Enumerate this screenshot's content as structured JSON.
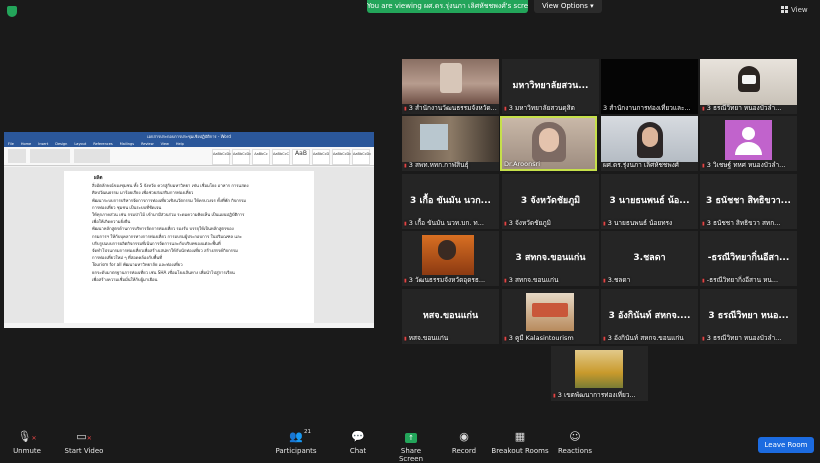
{
  "banner": {
    "text": "You are viewing ผศ.ดร.รุ่งนภา เลิศหัชชพงศ์'s screen"
  },
  "view_options": "View Options",
  "view_button": "View",
  "word": {
    "title": "เอกสารประกอบการประชุมเชิงปฏิบัติการ - Word",
    "tabs": [
      "File",
      "Home",
      "Insert",
      "Design",
      "Layout",
      "References",
      "Mailings",
      "Review",
      "View",
      "Help"
    ],
    "styles": [
      "AaBbCcDc",
      "AaBbCcDc",
      "AaBbCc",
      "AaBbCcC",
      "AaB",
      "AaBbCcD",
      "AaBbCcDc",
      "AaBbCcDc"
    ],
    "heading": "ผลิต",
    "lines": [
      "สิ่งอัตลักษณ์ของชุมชน ทั้ง 5 จังหวัด ควรสู่กับมหาวิทยา เช่น เชื่อมโยง อาหาร การแสดง",
      "ศิลปวัฒนธรรม มาร้อยเรียง เพื่อช่วยส่งเสริมการท่องเที่ยว",
      "พัฒนาระบบการบริหารจัดการการท่องเที่ยวเชิงนวัตกรรม ให้ครบวงจร ทั้งที่พัก กิจกรรม",
      "การท่องเที่ยว ชุมชน เป็นระบบที่ชัดเจน",
      "ให้ทุกภาคส่วน เช่น กรมป่าไม้ เข้ามามีส่วนร่วม ระดมความคิดเห็น เป็นแผนปฏิบัติการ",
      "เพื่อให้เกิดความยั่งยืน",
      "พัฒนาหลักสูตรด้านการบริหารจัดการท่องเที่ยว รองรับ บรรจุให้เป็นหลักสูตรของ",
      "กรมการฯ ให้กับบุคลากรทางการท่องเที่ยว การอบรมผู้ประกอบการ ในปริมณฑล และ",
      "ปรับรูปแบบการผลิตกิจกรรมที่เน้นการจัดการและกับบริบทของแต่ละพื้นที่",
      "จัดทำโปรแกรมการท่องเที่ยวเพื่อสร้างเสน่หาให้กับนักท่องเที่ยว สร้างสรรค์กิจกรรม",
      "การท่องเที่ยวใหม่ ๆ ที่สอดคล้องกับพื้นที่",
      "Tourism for all พัฒนามหาวิทยาลัย และท่องเที่ยว",
      "ยกระดับมาตรฐานการท่องเที่ยว เช่น SHA เชื่อมโยงเส้นทาง เพื่อนำไปสู่การเรียน",
      "เพื่อสร้างความเชื่อมั่นให้กับผู้มาเยือน"
    ]
  },
  "tiles": [
    {
      "label": "3 สำนักงานวัฒนธรรมจังหวัด...",
      "big": ""
    },
    {
      "label": "3 มหาวิทยาลัยสวนดุสิต",
      "big": "มหาวิทยาลัยสวน..."
    },
    {
      "label": "3 สำนักงานการท่องเที่ยวและ...",
      "big": ""
    },
    {
      "label": "3 ธรณีวิทยา หนองบัวลำ...",
      "big": ""
    },
    {
      "label": "3 สพท.หทก.กาฬสินธุ์",
      "big": ""
    },
    {
      "label": "Dr.Aroonsri",
      "big": ""
    },
    {
      "label": "ผศ.ดร.รุ่งนภา เลิศหัชชพงศ์",
      "big": ""
    },
    {
      "label": "3 วิเชษฐ์ ทหศ หนองบัวลำ...",
      "big": ""
    },
    {
      "label": "3 เกื้อ ขันมัน นวท.บก. ท...",
      "big": "3 เกื้อ ขันมัน นวก..."
    },
    {
      "label": "3 จังหวัดชัยภูมิ",
      "big": "3 จังหวัดชัยภูมิ"
    },
    {
      "label": "3 นายธนพนธ์ น้อยทรง",
      "big": "3 นายธนพนธ์ น้อ..."
    },
    {
      "label": "3 ธนัชชา สิทธิขวา สทก...",
      "big": "3 ธนัชชา สิทธิขวา..."
    },
    {
      "label": "3 วัฒนธรรมจังหวัดอุดรธ...",
      "big": ""
    },
    {
      "label": "3 สทกจ.ขอนแก่น",
      "big": "3 สทกจ.ขอนแก่น"
    },
    {
      "label": "3.ชลดา",
      "big": "3.ชลดา"
    },
    {
      "label": "-ธรณีวิทยากิ่งอีสาน หน...",
      "big": "-ธรณีวิทยากิ่นอีสา..."
    },
    {
      "label": "หสจ.ขอนแก่น",
      "big": "หสจ.ขอนแก่น"
    },
    {
      "label": "3 คูมี Kalasintourism",
      "big": ""
    },
    {
      "label": "3 อังกินันท์ สหกจ.ขอนแก่น",
      "big": "3 อังกินันท์ สหกจ...."
    },
    {
      "label": "3 ธรณีวิทยา หนองบัวลำ...",
      "big": "3 ธรณีวิทยา หนอ..."
    },
    {
      "label": "3 เขตพัฒนาการท่องเที่ยว...",
      "big": ""
    }
  ],
  "toolbar": {
    "unmute": "Unmute",
    "start_video": "Start Video",
    "participants": "Participants",
    "participants_count": "21",
    "chat": "Chat",
    "share_screen": "Share Screen",
    "record": "Record",
    "breakout": "Breakout Rooms",
    "reactions": "Reactions",
    "leave": "Leave Room"
  }
}
